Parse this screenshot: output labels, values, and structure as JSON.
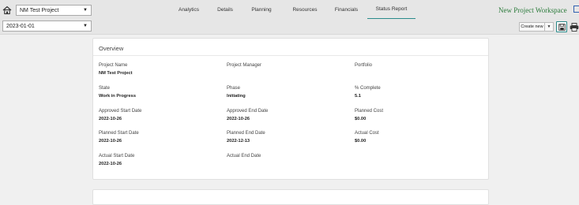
{
  "toolbar": {
    "project_select_value": "NM Test Project",
    "date_select_value": "2023-01-01",
    "tabs": [
      {
        "label": "Analytics"
      },
      {
        "label": "Details"
      },
      {
        "label": "Planning"
      },
      {
        "label": "Resources"
      },
      {
        "label": "Financials"
      },
      {
        "label": "Status Report"
      }
    ],
    "active_tab": "Status Report",
    "workspace_link": "New Project Workspace",
    "create_new_label": "Create new"
  },
  "overview": {
    "title": "Overview",
    "fields": [
      {
        "label": "Project Name",
        "value": "NM Test Project"
      },
      {
        "label": "Project Manager",
        "value": ""
      },
      {
        "label": "Portfolio",
        "value": ""
      },
      {
        "label": "State",
        "value": "Work in Progress"
      },
      {
        "label": "Phase",
        "value": "Initiating"
      },
      {
        "label": "% Complete",
        "value": "5.1"
      },
      {
        "label": "Approved Start Date",
        "value": "2022-10-26"
      },
      {
        "label": "Approved End Date",
        "value": "2022-10-26"
      },
      {
        "label": "Planned Cost",
        "value": "$0.00"
      },
      {
        "label": "Planned Start Date",
        "value": "2022-10-26"
      },
      {
        "label": "Planned End Date",
        "value": "2022-12-13"
      },
      {
        "label": "Actual Cost",
        "value": "$0.00"
      },
      {
        "label": "Actual Start Date",
        "value": "2022-10-26"
      },
      {
        "label": "Actual End Date",
        "value": ""
      }
    ]
  },
  "colors": {
    "accent": "#2a8a8a",
    "workspace_link": "#2a7a3a"
  }
}
